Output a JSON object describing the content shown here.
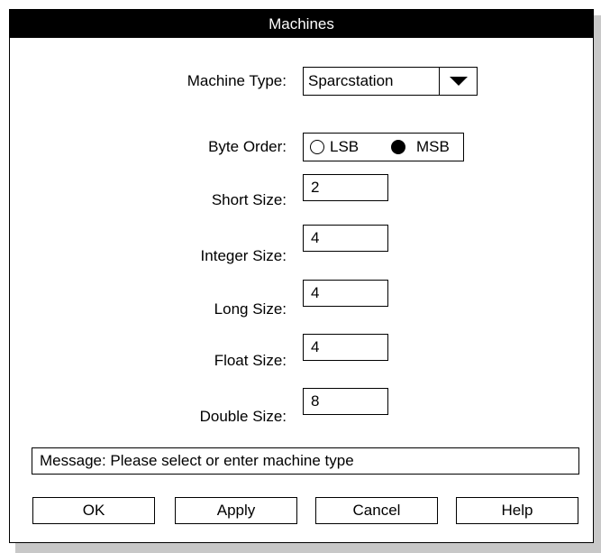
{
  "dialog": {
    "title": "Machines"
  },
  "form": {
    "machine_type": {
      "label": "Machine Type:",
      "value": "Sparcstation"
    },
    "byte_order": {
      "label": "Byte Order:",
      "options": [
        {
          "label": "LSB",
          "selected": false
        },
        {
          "label": "MSB",
          "selected": true
        }
      ]
    },
    "short_size": {
      "label": "Short Size:",
      "value": "2"
    },
    "integer_size": {
      "label": "Integer Size:",
      "value": "4"
    },
    "long_size": {
      "label": "Long Size:",
      "value": "4"
    },
    "float_size": {
      "label": "Float Size:",
      "value": "4"
    },
    "double_size": {
      "label": "Double Size:",
      "value": "8"
    }
  },
  "message": "Message: Please select or enter machine type",
  "buttons": {
    "ok": "OK",
    "apply": "Apply",
    "cancel": "Cancel",
    "help": "Help"
  },
  "icons": {
    "dropdown": "triangle-down-icon"
  }
}
